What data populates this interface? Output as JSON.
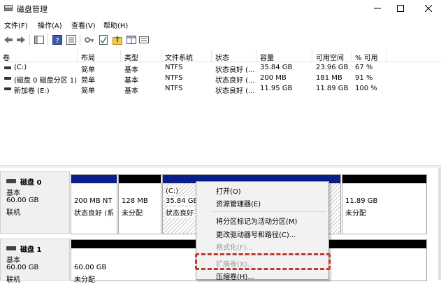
{
  "window": {
    "title": "磁盘管理",
    "minimize_glyph": "—",
    "maximize_glyph": "☐",
    "close_glyph": "✕"
  },
  "menu": {
    "file": "文件(F)",
    "action": "操作(A)",
    "view": "查看(V)",
    "help": "帮助(H)"
  },
  "toolbar": {
    "icons": [
      "back-icon",
      "forward-icon",
      "show-hide-console-icon",
      "help-icon",
      "properties-icon",
      "connect-icon",
      "check-icon",
      "export-icon",
      "folder-up-icon",
      "view-icon"
    ]
  },
  "volume_list": {
    "headers": {
      "volume": "卷",
      "layout": "布局",
      "type": "类型",
      "filesystem": "文件系统",
      "status": "状态",
      "capacity": "容量",
      "free": "可用空间",
      "percent_free": "% 可用"
    },
    "rows": [
      {
        "volume": "(C:)",
        "layout": "简单",
        "type": "基本",
        "filesystem": "NTFS",
        "status": "状态良好 (...",
        "capacity": "35.84 GB",
        "free": "23.96 GB",
        "percent_free": "67 %"
      },
      {
        "volume": "(磁盘 0 磁盘分区 1)",
        "layout": "简单",
        "type": "基本",
        "filesystem": "NTFS",
        "status": "状态良好 (...",
        "capacity": "200 MB",
        "free": "181 MB",
        "percent_free": "91 %"
      },
      {
        "volume": "新加卷 (E:)",
        "layout": "简单",
        "type": "基本",
        "filesystem": "NTFS",
        "status": "状态良好 (...",
        "capacity": "11.95 GB",
        "free": "11.89 GB",
        "percent_free": "100 %"
      }
    ]
  },
  "disks": [
    {
      "name": "磁盘 0",
      "type": "基本",
      "size": "60.00 GB",
      "state": "联机",
      "partitions": [
        {
          "line1": "",
          "line2": "200 MB NT",
          "line3": "状态良好 (系"
        },
        {
          "line1": "",
          "line2": "128 MB",
          "line3": "未分配"
        },
        {
          "line1": "(C:)",
          "line2": "35.84 GB",
          "line3": "状态良好"
        },
        {
          "line1": "",
          "line2": "11.89 GB",
          "line3": "未分配"
        }
      ]
    },
    {
      "name": "磁盘 1",
      "type": "基本",
      "size": "60.00 GB",
      "state": "联机",
      "partitions": [
        {
          "line1": "",
          "line2": "60.00 GB",
          "line3": "未分配"
        }
      ]
    }
  ],
  "context_menu": {
    "open": "打开(O)",
    "explorer": "资源管理器(E)",
    "mark_active": "将分区标记为活动分区(M)",
    "change_letter": "更改驱动器号和路径(C)...",
    "format": "格式化(F)...",
    "extend": "扩展卷(X)...",
    "shrink": "压缩卷(H)..."
  },
  "colors": {
    "primary_partition_bar": "#0a1f8a",
    "unallocated_bar": "#000000",
    "highlight_dash": "#c0392b"
  }
}
